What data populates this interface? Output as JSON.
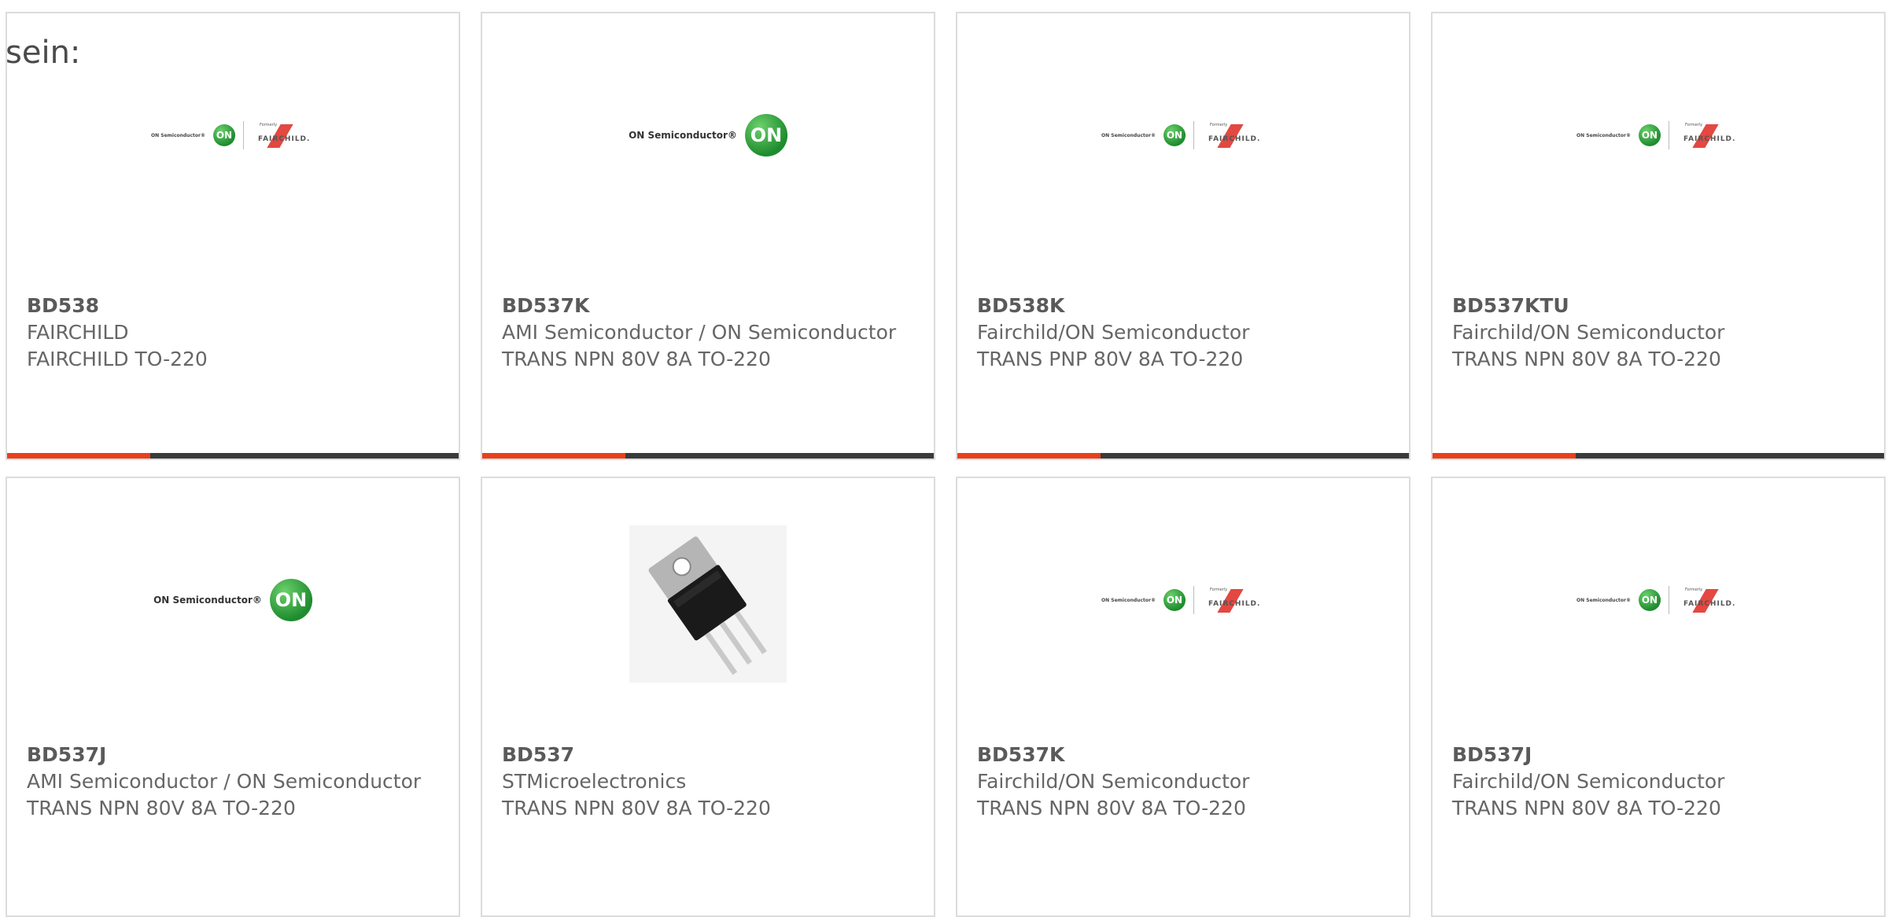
{
  "intro_text": "sein:",
  "colors": {
    "accent": "#e8401c",
    "bar": "#3a3a3a",
    "text": "#666666",
    "border": "#dcdcdc"
  },
  "products": [
    {
      "part": "BD538",
      "manufacturer": "FAIRCHILD",
      "description": "FAIRCHILD TO-220",
      "logo": "on-semi-fairchild-logo",
      "logo_on_text": "ON Semiconductor®",
      "logo_on_mark": "ON",
      "logo_formerly": "Formerly",
      "logo_fairchild": "FAIRCHILD."
    },
    {
      "part": "BD537K",
      "manufacturer": "AMI Semiconductor / ON Semiconductor",
      "description": "TRANS NPN 80V 8A TO-220",
      "logo": "on-semiconductor-logo",
      "logo_on_text": "ON Semiconductor®",
      "logo_on_mark": "ON"
    },
    {
      "part": "BD538K",
      "manufacturer": "Fairchild/ON Semiconductor",
      "description": "TRANS PNP 80V 8A TO-220",
      "logo": "on-semi-fairchild-logo",
      "logo_on_text": "ON Semiconductor®",
      "logo_on_mark": "ON",
      "logo_formerly": "Formerly",
      "logo_fairchild": "FAIRCHILD."
    },
    {
      "part": "BD537KTU",
      "manufacturer": "Fairchild/ON Semiconductor",
      "description": "TRANS NPN 80V 8A TO-220",
      "logo": "on-semi-fairchild-logo",
      "logo_on_text": "ON Semiconductor®",
      "logo_on_mark": "ON",
      "logo_formerly": "Formerly",
      "logo_fairchild": "FAIRCHILD."
    },
    {
      "part": "BD537J",
      "manufacturer": "AMI Semiconductor / ON Semiconductor",
      "description": "TRANS NPN 80V 8A TO-220",
      "logo": "on-semiconductor-logo",
      "logo_on_text": "ON Semiconductor®",
      "logo_on_mark": "ON"
    },
    {
      "part": "BD537",
      "manufacturer": "STMicroelectronics",
      "description": "TRANS NPN 80V 8A TO-220",
      "logo": "transistor-to220-image"
    },
    {
      "part": "BD537K",
      "manufacturer": "Fairchild/ON Semiconductor",
      "description": "TRANS NPN 80V 8A TO-220",
      "logo": "on-semi-fairchild-logo",
      "logo_on_text": "ON Semiconductor®",
      "logo_on_mark": "ON",
      "logo_formerly": "Formerly",
      "logo_fairchild": "FAIRCHILD."
    },
    {
      "part": "BD537J",
      "manufacturer": "Fairchild/ON Semiconductor",
      "description": "TRANS NPN 80V 8A TO-220",
      "logo": "on-semi-fairchild-logo",
      "logo_on_text": "ON Semiconductor®",
      "logo_on_mark": "ON",
      "logo_formerly": "Formerly",
      "logo_fairchild": "FAIRCHILD."
    }
  ]
}
